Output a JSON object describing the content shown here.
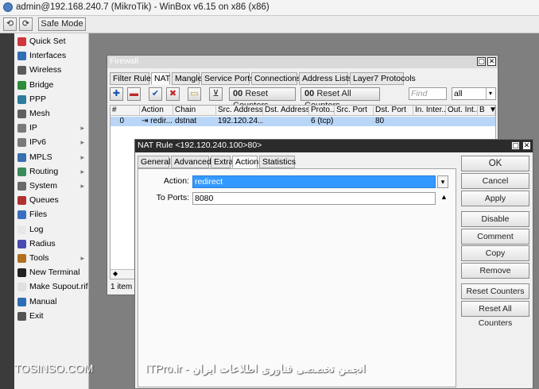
{
  "app": {
    "title": "admin@192.168.240.7 (MikroTik) - WinBox v6.15 on x86 (x86)"
  },
  "toolbar": {
    "undo_icon": "undo-icon",
    "redo_icon": "redo-icon",
    "safe_mode_label": "Safe Mode"
  },
  "sidebar": {
    "items": [
      {
        "label": "Quick Set",
        "icon": "quick-set-icon",
        "color": "#d0363b",
        "submenu": false
      },
      {
        "label": "Interfaces",
        "icon": "interfaces-icon",
        "color": "#2f6db5",
        "submenu": false
      },
      {
        "label": "Wireless",
        "icon": "wireless-icon",
        "color": "#5a5a5a",
        "submenu": false
      },
      {
        "label": "Bridge",
        "icon": "bridge-icon",
        "color": "#2c8c3a",
        "submenu": false
      },
      {
        "label": "PPP",
        "icon": "ppp-icon",
        "color": "#2c7c9c",
        "submenu": false
      },
      {
        "label": "Mesh",
        "icon": "mesh-icon",
        "color": "#606060",
        "submenu": false
      },
      {
        "label": "IP",
        "icon": "ip-icon",
        "color": "#7a7a7a",
        "submenu": true
      },
      {
        "label": "IPv6",
        "icon": "ipv6-icon",
        "color": "#7a7a7a",
        "submenu": true
      },
      {
        "label": "MPLS",
        "icon": "mpls-icon",
        "color": "#3a6fb0",
        "submenu": true
      },
      {
        "label": "Routing",
        "icon": "routing-icon",
        "color": "#3a8a5a",
        "submenu": true
      },
      {
        "label": "System",
        "icon": "system-icon",
        "color": "#6a6a6a",
        "submenu": true
      },
      {
        "label": "Queues",
        "icon": "queues-icon",
        "color": "#b03030",
        "submenu": false
      },
      {
        "label": "Files",
        "icon": "files-icon",
        "color": "#3a6fc0",
        "submenu": false
      },
      {
        "label": "Log",
        "icon": "log-icon",
        "color": "#e8e8e8",
        "submenu": false
      },
      {
        "label": "Radius",
        "icon": "radius-icon",
        "color": "#4a4ab0",
        "submenu": false
      },
      {
        "label": "Tools",
        "icon": "tools-icon",
        "color": "#b07020",
        "submenu": true
      },
      {
        "label": "New Terminal",
        "icon": "terminal-icon",
        "color": "#222222",
        "submenu": false
      },
      {
        "label": "Make Supout.rif",
        "icon": "supout-icon",
        "color": "#e0e0e0",
        "submenu": false
      },
      {
        "label": "Manual",
        "icon": "manual-icon",
        "color": "#2f6db5",
        "submenu": false
      },
      {
        "label": "Exit",
        "icon": "exit-icon",
        "color": "#555555",
        "submenu": false
      }
    ]
  },
  "firewall": {
    "title": "Firewall",
    "tabs": [
      "Filter Rules",
      "NAT",
      "Mangle",
      "Service Ports",
      "Connections",
      "Address Lists",
      "Layer7 Protocols"
    ],
    "active_tab": "NAT",
    "reset_counters": "Reset Counters",
    "reset_all_counters": "Reset All Counters",
    "find_placeholder": "Find",
    "filter_select": "all",
    "columns": [
      "#",
      "Action",
      "Chain",
      "Src. Address",
      "Dst. Address",
      "Proto...",
      "Src. Port",
      "Dst. Port",
      "In. Inter...",
      "Out. Int...",
      "B"
    ],
    "rows": [
      {
        "num": "0",
        "action": "redir...",
        "chain": "dstnat",
        "src": "192.120.24...",
        "dst": "",
        "proto": "6 (tcp)",
        "sport": "",
        "dport": "80",
        "in": "",
        "out": "",
        "b": ""
      }
    ],
    "status": "1 item ("
  },
  "nat_rule": {
    "title": "NAT Rule <192.120.240.100>80>",
    "tabs": [
      "General",
      "Advanced",
      "Extra",
      "Action",
      "Statistics"
    ],
    "active_tab": "Action",
    "action_label": "Action:",
    "action_value": "redirect",
    "to_ports_label": "To Ports:",
    "to_ports_value": "8080",
    "buttons": [
      "OK",
      "Cancel",
      "Apply",
      "Disable",
      "Comment",
      "Copy",
      "Remove",
      "Reset Counters",
      "Reset All Counters"
    ]
  },
  "footer": {
    "left": "TOSINSO.COM",
    "right": "ITPro.ir - انجمن تخصصی فناوری اطلاعات ایران"
  },
  "colors": {
    "accent": "#3399ff",
    "selected_row": "#b9d6f7",
    "window_title_active": "#1c1c1c"
  }
}
